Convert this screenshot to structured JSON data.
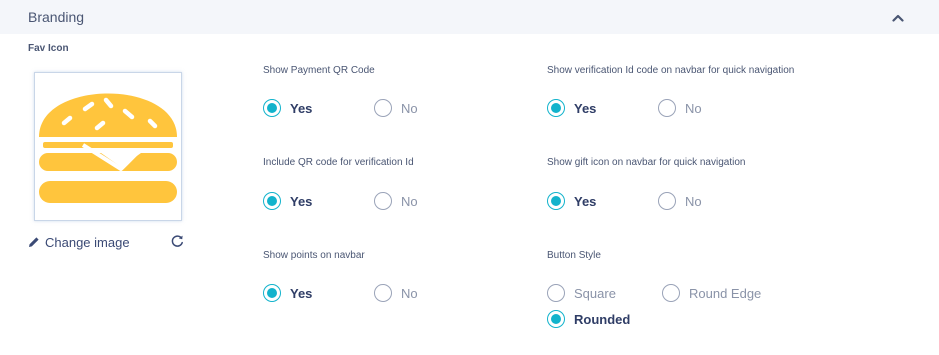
{
  "section": {
    "title": "Branding"
  },
  "fav_icon": {
    "label": "Fav Icon",
    "change_label": "Change image",
    "image_icon": "burger-icon"
  },
  "settings": {
    "payment_qr": {
      "label": "Show Payment QR Code",
      "yes": "Yes",
      "no": "No",
      "value": "Yes"
    },
    "verification_navbar": {
      "label": "Show verification Id code on navbar for quick navigation",
      "yes": "Yes",
      "no": "No",
      "value": "Yes"
    },
    "qr_verification": {
      "label": "Include QR code for verification Id",
      "yes": "Yes",
      "no": "No",
      "value": "Yes"
    },
    "gift_navbar": {
      "label": "Show gift icon on navbar for quick navigation",
      "yes": "Yes",
      "no": "No",
      "value": "Yes"
    },
    "points_navbar": {
      "label": "Show points on navbar",
      "yes": "Yes",
      "no": "No",
      "value": "Yes"
    },
    "button_style": {
      "label": "Button Style",
      "square": "Square",
      "round_edge": "Round Edge",
      "rounded": "Rounded",
      "value": "Rounded"
    }
  },
  "colors": {
    "accent": "#12b3cc",
    "burger": "#ffc53d",
    "header_bg": "#f4f6fa"
  }
}
